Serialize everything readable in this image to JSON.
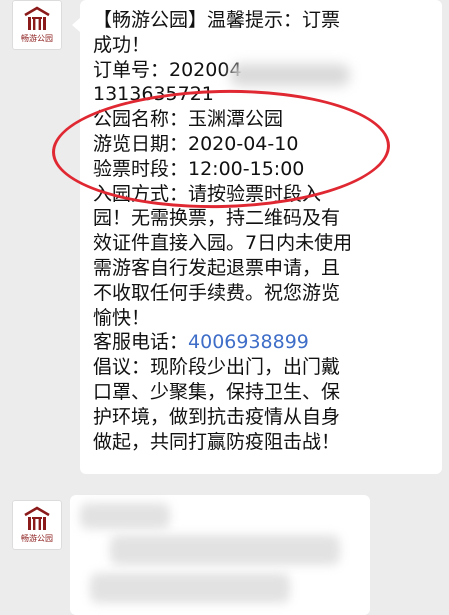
{
  "sender": {
    "name": "畅游公园",
    "logo_icon": "park-gate-logo-icon",
    "brand_color": "#8b1a1a"
  },
  "message": {
    "lines": [
      "【畅游公园】温馨提示：订票",
      "成功！",
      "订单号：202004",
      "1313635721",
      "公园名称：玉渊潭公园",
      "游览日期：2020-04-10",
      "验票时段：12:00-15:00",
      "入园方式：请按验票时段入",
      "园！无需换票，持二维码及有",
      "效证件直接入园。7日内未使用",
      "需游客自行发起退票申请，且",
      "不收取任何手续费。祝您游览",
      "愉快！",
      "客服电话："
    ],
    "phone": "4006938899",
    "closing_lines": [
      "倡议：现阶段少出门，出门戴",
      "口罩、少聚集，保持卫生、保",
      "护环境，做到抗击疫情从自身",
      "做起，共同打赢防疫阻击战！"
    ],
    "link_color": "#3f6ec8",
    "highlight_color": "#e02832"
  }
}
